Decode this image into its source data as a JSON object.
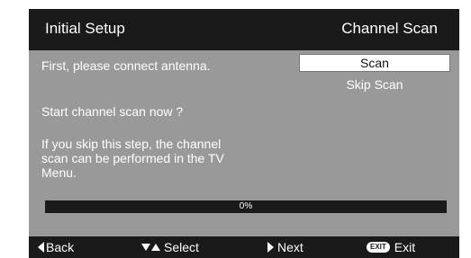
{
  "header": {
    "title": "Initial Setup",
    "page_name": "Channel Scan"
  },
  "content": {
    "instruction": "First, please connect antenna.",
    "question": "Start channel scan now ?",
    "note": "If you skip this step, the channel scan can be performed in the TV Menu."
  },
  "options": {
    "scan": "Scan",
    "skip": "Skip Scan",
    "selected": "Scan"
  },
  "progress": {
    "label": "0%",
    "value": 0
  },
  "footer": {
    "back": "Back",
    "select": "Select",
    "next": "Next",
    "exit_key": "EXIT",
    "exit": "Exit"
  },
  "icons": {
    "back": "triangle-left-icon",
    "select": "triangle-up-down-icon",
    "next": "triangle-right-icon",
    "exit": "exit-key-icon"
  },
  "colors": {
    "bar_background": "#1a1a1a",
    "panel_background": "#999999",
    "highlight": "#ffffff"
  }
}
